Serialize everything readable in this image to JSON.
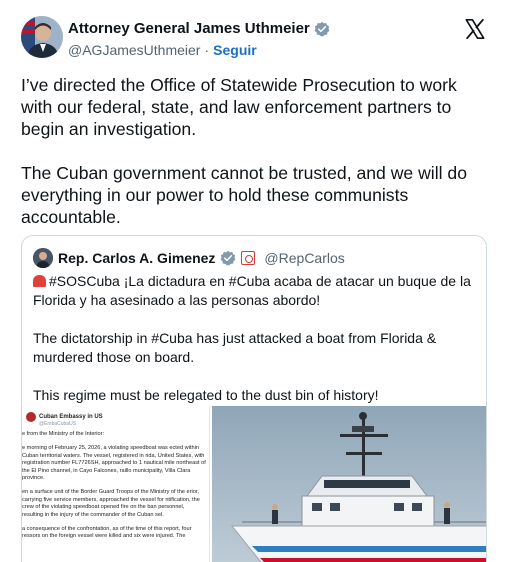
{
  "author": {
    "name": "Attorney General James Uthmeier",
    "handle": "@AGJamesUthmeier",
    "separator": "·",
    "follow_label": "Seguir",
    "verified_icon": "verified-badge-icon"
  },
  "tweet": {
    "paragraph_1": "I’ve directed the Office of Statewide Prosecution to work with our federal, state, and law enforcement partners to begin an investigation.",
    "paragraph_2": "The Cuban government cannot be trusted, and we will do everything in our power to hold these communists accountable."
  },
  "quoted": {
    "name": "Rep. Carlos A. Gimenez",
    "handle": "@RepCarlos",
    "paragraph_1": "#SOSCuba ¡La dictadura en #Cuba acaba de atacar un buque de la Florida y ha asesinado a las personas abordo!",
    "paragraph_2": "The dictatorship in #Cuba has just attacked a boat from Florida & murdered those on board.",
    "paragraph_3": "This regime must be relegated to the dust bin of history!",
    "media": {
      "doc_title": "Cuban Embassy in US",
      "doc_handle": "@EmbaCubaUS",
      "doc_p1": "e from the Ministry of the Interior:",
      "doc_p2": "e morning of February 25, 2026, a violating speedboat was ected within Cuban territorial waters. The vessel, registered in rida, United States, with registration number FL7726SH, approached to 1 nautical mile northeast of the El Pino channel, in Cayo Falcones, raillo municipality, Villa Clara province.",
      "doc_p3": "en a surface unit of the Border Guard Troops of the Ministry of the erior, carrying five service members, approached the vessel for ntification, the crew of the violating speedboat opened fire on the ban personnel, resulting in the injury of the commander of the Cuban sel.",
      "doc_p4": "a consequence of the confrontation, as of the time of this report, four ressors on the foreign vessel were killed and six were injured. The"
    }
  },
  "colors": {
    "text": "#0f1419",
    "secondary": "#536471",
    "follow": "#1d6fc2",
    "border": "#cfd9de",
    "verified": "#829aab"
  }
}
